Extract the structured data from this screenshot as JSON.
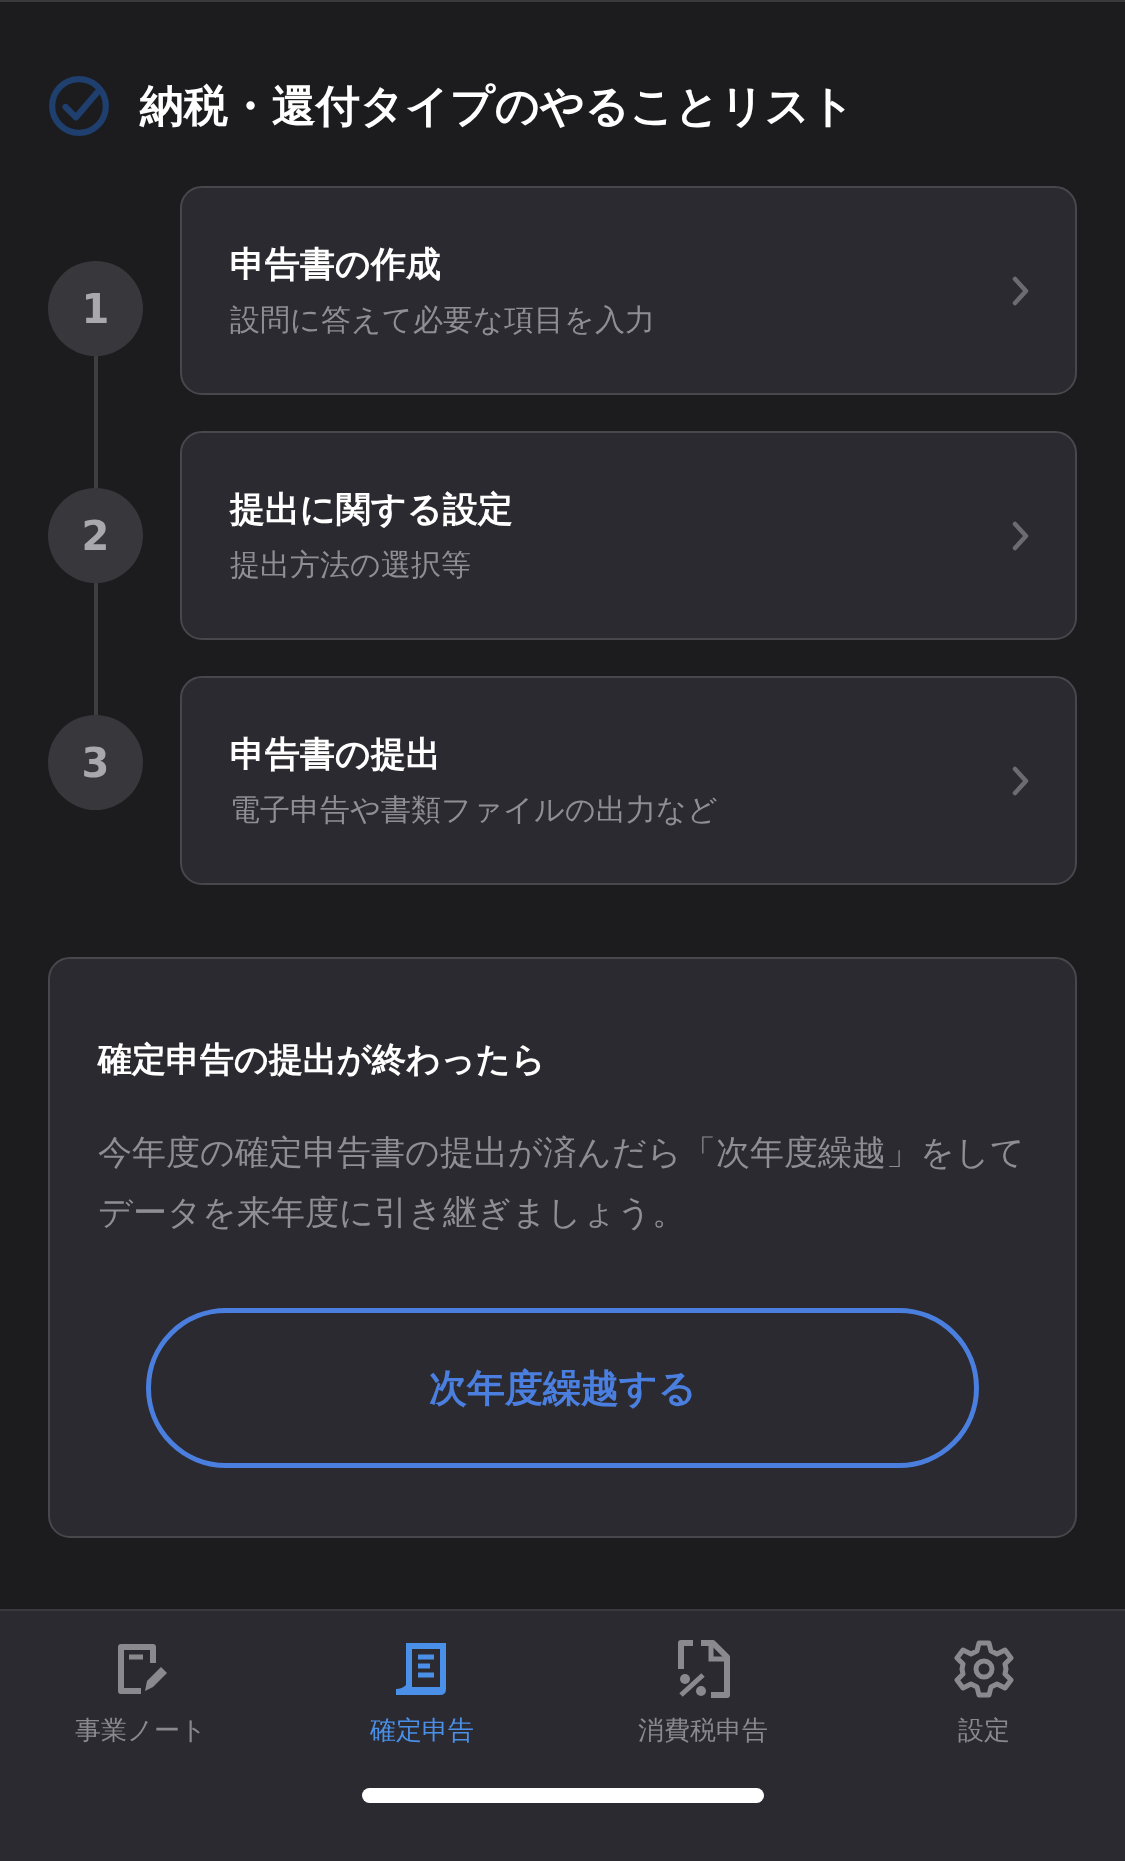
{
  "header": {
    "title": "納税・還付タイプのやることリスト"
  },
  "steps": [
    {
      "number": "1",
      "title": "申告書の作成",
      "subtitle": "設問に答えて必要な項目を入力"
    },
    {
      "number": "2",
      "title": "提出に関する設定",
      "subtitle": "提出方法の選択等"
    },
    {
      "number": "3",
      "title": "申告書の提出",
      "subtitle": "電子申告や書類ファイルの出力など"
    }
  ],
  "notice": {
    "title": "確定申告の提出が終わったら",
    "body": "今年度の確定申告書の提出が済んだら「次年度繰越」をしてデータを来年度に引き継ぎましょう。",
    "button": "次年度繰越する"
  },
  "tab_bar": [
    {
      "label": "事業ノート",
      "selected": false
    },
    {
      "label": "確定申告",
      "selected": true
    },
    {
      "label": "消費税申告",
      "selected": false
    },
    {
      "label": "設定",
      "selected": false
    }
  ]
}
